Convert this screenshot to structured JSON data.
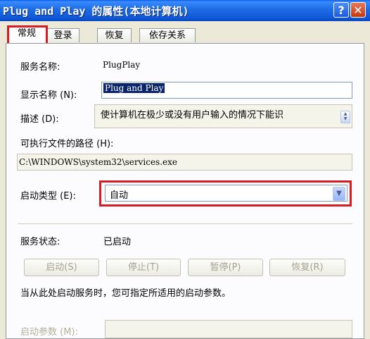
{
  "window": {
    "title": "Plug and Play 的属性(本地计算机)",
    "help_label": "?",
    "close_label": "✕"
  },
  "tabs": [
    {
      "label": "常规",
      "active": true
    },
    {
      "label": "登录",
      "active": false
    },
    {
      "label": "恢复",
      "active": false
    },
    {
      "label": "依存关系",
      "active": false
    }
  ],
  "general": {
    "service_name_label": "服务名称:",
    "service_name_value": "PlugPlay",
    "display_name_label": "显示名称 (N):",
    "display_name_value": "Plug and Play",
    "description_label": "描述 (D):",
    "description_value": "使计算机在极少或没有用户输入的情况下能识",
    "exe_path_label": "可执行文件的路径 (H):",
    "exe_path_value": "C:\\WINDOWS\\system32\\services.exe",
    "startup_type_label": "启动类型 (E):",
    "startup_type_value": "自动",
    "service_status_label": "服务状态:",
    "service_status_value": "已启动",
    "buttons": {
      "start": "启动(S)",
      "stop": "停止(T)",
      "pause": "暂停(P)",
      "resume": "恢复(R)"
    },
    "hint_text": "当从此处启动服务时，您可指定所适用的启动参数。",
    "start_params_label": "启动参数 (M):"
  },
  "colors": {
    "titlebar": "#0f57d6",
    "highlight_box": "#d71c24",
    "selection": "#0a246a"
  }
}
